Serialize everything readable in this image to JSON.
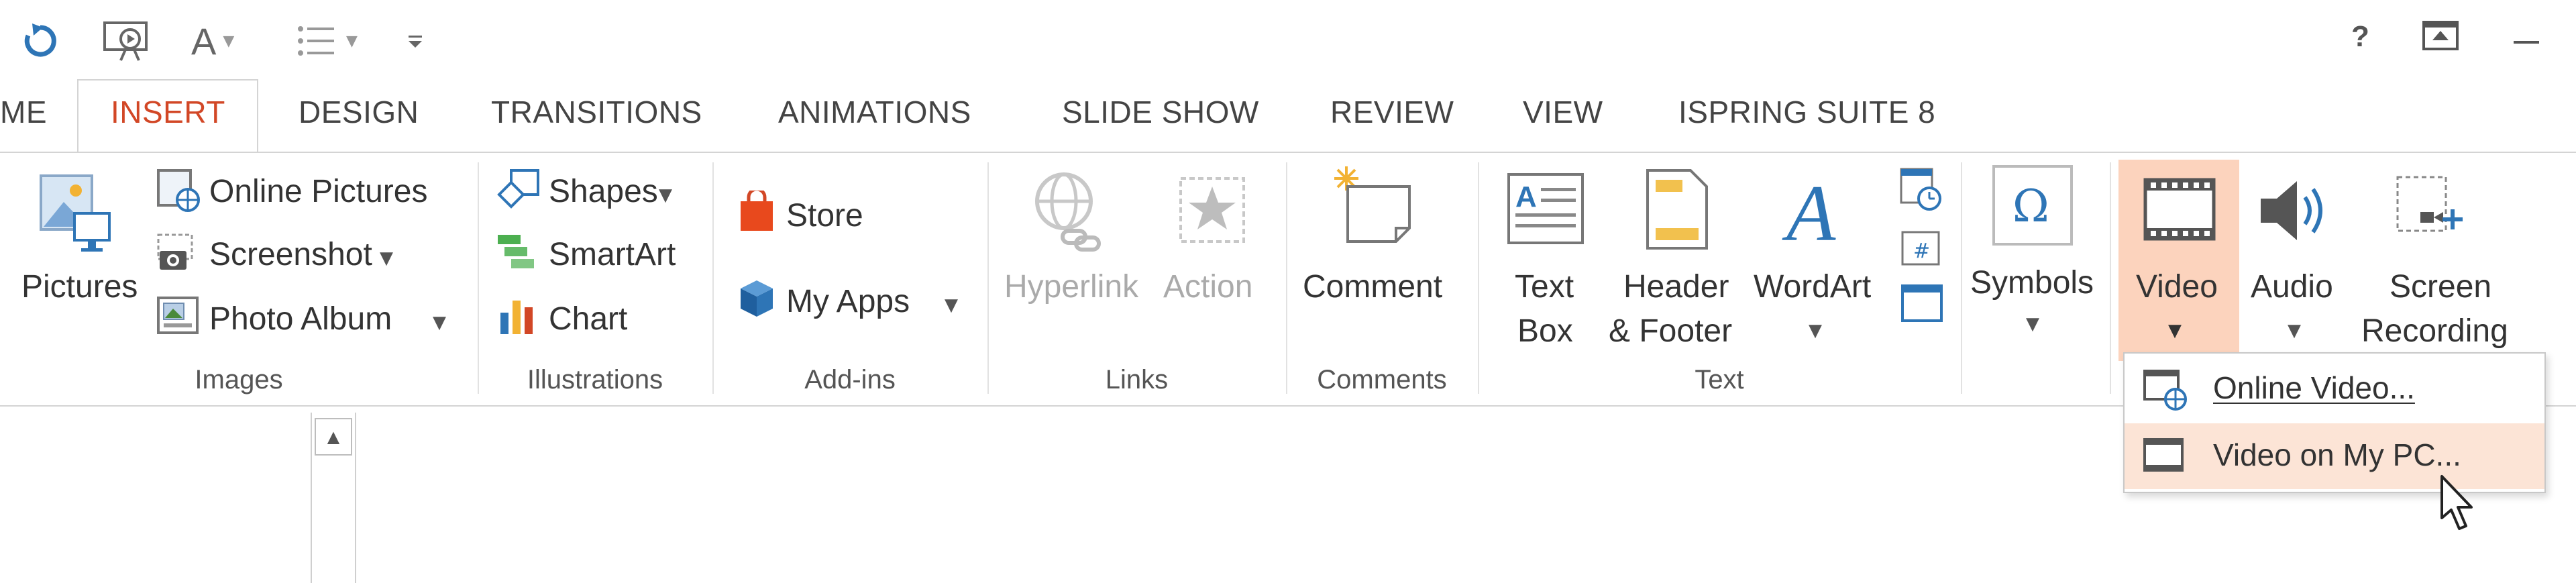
{
  "quick_access": {
    "undo_icon": "refresh-icon",
    "slideshow_icon": "start-from-beginning-icon",
    "font_letter": "A",
    "list_icon": "bullets-icon",
    "customize_icon": "customize-qat-icon",
    "help": "?"
  },
  "tabs": {
    "partial": "ME",
    "insert": "INSERT",
    "design": "DESIGN",
    "transitions": "TRANSITIONS",
    "animations": "ANIMATIONS",
    "slideshow": "SLIDE SHOW",
    "review": "REVIEW",
    "view": "VIEW",
    "ispring": "ISPRING SUITE 8"
  },
  "groups": {
    "images": {
      "label": "Images",
      "pictures": "Pictures",
      "online_pictures": "Online Pictures",
      "screenshot": "Screenshot",
      "photo_album": "Photo Album"
    },
    "illustrations": {
      "label": "Illustrations",
      "shapes": "Shapes",
      "smartart": "SmartArt",
      "chart": "Chart"
    },
    "addins": {
      "label": "Add-ins",
      "store": "Store",
      "my_apps": "My Apps"
    },
    "links": {
      "label": "Links",
      "hyperlink": "Hyperlink",
      "action": "Action"
    },
    "comments": {
      "label": "Comments",
      "comment": "Comment"
    },
    "text": {
      "label": "Text",
      "text_box_1": "Text",
      "text_box_2": "Box",
      "header_1": "Header",
      "header_2": "& Footer",
      "wordart": "WordArt"
    },
    "symbols": {
      "symbols": "Symbols"
    },
    "media": {
      "video": "Video",
      "audio": "Audio",
      "screen_1": "Screen",
      "screen_2": "Recording"
    }
  },
  "video_menu": {
    "online_video": "Online Video...",
    "video_on_pc": "Video on My PC..."
  },
  "colors": {
    "accent": "#d24726",
    "video_highlight": "#fcd3bd",
    "menu_highlight": "#fce4d6"
  }
}
